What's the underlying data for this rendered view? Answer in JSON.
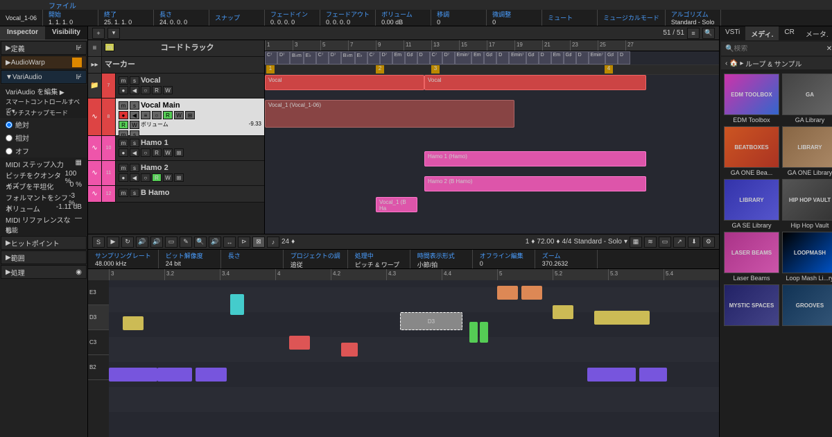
{
  "title": "Vocal_1-06",
  "topMenu": [
    "ファイル"
  ],
  "infoBar": [
    {
      "lbl": "開始",
      "val": "1. 1. 1. 0"
    },
    {
      "lbl": "終了",
      "val": "25. 1. 1. 0"
    },
    {
      "lbl": "長さ",
      "val": "24. 0. 0. 0"
    },
    {
      "lbl": "スナップ",
      "val": ""
    },
    {
      "lbl": "フェードイン",
      "val": "0. 0. 0. 0"
    },
    {
      "lbl": "フェードアウト",
      "val": "0. 0. 0. 0"
    },
    {
      "lbl": "ボリューム",
      "val": "0.00 dB"
    },
    {
      "lbl": "移調",
      "val": "0"
    },
    {
      "lbl": "微調整",
      "val": "0"
    },
    {
      "lbl": "ミュート",
      "val": ""
    },
    {
      "lbl": "ミュージカルモード",
      "val": ""
    },
    {
      "lbl": "アルゴリズム",
      "val": "Standard - Solo"
    }
  ],
  "inspector": {
    "tabs": [
      "Inspector",
      "Visibility"
    ],
    "items": {
      "def": "定義",
      "aw": "AudioWarp",
      "va": "VariAudio",
      "vaedit": "VariAudio を編集",
      "smart": "スマートコントロールすべて▾",
      "psnap": "ピッチスナップモード",
      "r1": "絶対",
      "r2": "相対",
      "r3": "オフ",
      "midi": "MIDI ステップ入力",
      "pq": "ピッチをクオンタイズ",
      "pqv": "100 %",
      "cv": "カーブを平坦化",
      "cvv": "0 %",
      "fm": "フォルマントをシフト",
      "fmv": "-3 %",
      "vol": "ボリューム",
      "volv": "-1.11 dB",
      "midiref": "MIDI リファレンスなし",
      "func": "機能",
      "hp": "ヒットポイント",
      "rng": "範囲",
      "proc": "処理"
    }
  },
  "tracks": {
    "chord": "コードトラック",
    "marker": "マーカー",
    "list": [
      {
        "name": "Vocal",
        "num": "7"
      },
      {
        "name": "Vocal Main",
        "num": "8",
        "sel": true
      },
      {
        "name": "Hamo 1",
        "num": "10"
      },
      {
        "name": "Hamo 2",
        "num": "11"
      },
      {
        "name": "B Hamo",
        "num": "12"
      }
    ],
    "autoLabel": "ボリューム",
    "autoVal": "-9.33"
  },
  "toolbar": {
    "count": "51 / 51"
  },
  "ruler": [
    "1",
    "3",
    "5",
    "7",
    "9",
    "11",
    "13",
    "15",
    "17",
    "19",
    "21",
    "23",
    "25",
    "27"
  ],
  "chords": [
    "C⁷",
    "D⁷",
    "B♭m",
    "E♭",
    "C⁷",
    "D⁷",
    "B♭m",
    "E♭",
    "C⁷",
    "D⁷",
    "Em",
    "G♯",
    "D",
    "C⁷",
    "D⁷",
    "Emin⁷",
    "Em",
    "G♯",
    "D",
    "Emin⁷",
    "G♯",
    "D",
    "Em",
    "G♯",
    "D",
    "Emin⁷",
    "G♯",
    "D"
  ],
  "markers": [
    "1",
    "2",
    "3",
    "4"
  ],
  "clips": {
    "vocal1": "Vocal",
    "vocal2": "Vocal",
    "vmain": "Vocal_1 (Vocal_1-06)",
    "hamo1": "Hamo 1 (Hamo)",
    "hamo2": "Hamo 2 (B Hamo)",
    "bhamo": "Vocal_1 (B Ha"
  },
  "editor": {
    "vals": {
      "zoom": "24",
      "one": "1",
      "tempo": "72.00",
      "sig": "4/4",
      "algo": "Standard - Solo"
    },
    "info": [
      {
        "lbl": "サンプリングレート",
        "val": "48.000 kHz"
      },
      {
        "lbl": "ビット解像度",
        "val": "24 bit"
      },
      {
        "lbl": "長さ",
        "val": ""
      },
      {
        "lbl": "プロジェクトの調",
        "val": "追従"
      },
      {
        "lbl": "処理中",
        "val": "ピッチ & ワープ"
      },
      {
        "lbl": "時間表示形式",
        "val": "小節/拍"
      },
      {
        "lbl": "オフライン編集",
        "val": "0"
      },
      {
        "lbl": "ズーム",
        "val": "370.2632"
      }
    ],
    "ruler": [
      "3",
      "3.2",
      "3.4",
      "4",
      "4.2",
      "4.3",
      "4.4",
      "5",
      "5.2",
      "5.3",
      "5.4"
    ],
    "keys": [
      "E3",
      "D3",
      "C3",
      "B2"
    ],
    "selNote": "D3"
  },
  "rightPanel": {
    "tabs": [
      "VSTi",
      "メディ.",
      "CR",
      "メータ."
    ],
    "search": "検索",
    "bread": "ループ & サンプル",
    "items": [
      {
        "t": "EDM TOOLBOX",
        "l": "EDM Toolbox"
      },
      {
        "t": "GA",
        "l": "GA Library"
      },
      {
        "t": "BEATBOXES",
        "l": "GA ONE Bea..."
      },
      {
        "t": "LIBRARY",
        "l": "GA ONE Library"
      },
      {
        "t": "LIBRARY",
        "l": "GA SE Library"
      },
      {
        "t": "HIP HOP VAULT",
        "l": "Hip Hop Vault"
      },
      {
        "t": "LASER BEAMS",
        "l": "Laser Beams"
      },
      {
        "t": "LOOPMASH",
        "l": "Loop Mash Li...ry"
      },
      {
        "t": "MYSTIC SPACES",
        "l": ""
      },
      {
        "t": "GROOVES",
        "l": ""
      }
    ]
  }
}
